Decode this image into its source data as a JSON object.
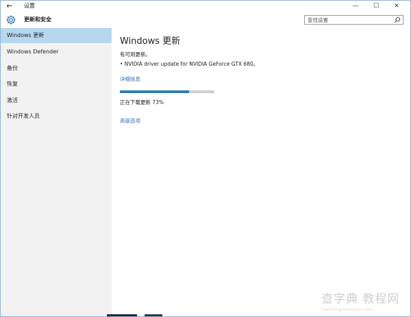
{
  "window": {
    "back_glyph": "←",
    "title": "设置",
    "controls": {
      "minimize": "—",
      "maximize": "☐",
      "close": "✕"
    }
  },
  "header": {
    "title": "更新和安全",
    "icon": "gear-icon"
  },
  "search": {
    "placeholder": "查找设置",
    "icon": "search-icon"
  },
  "sidebar": {
    "items": [
      {
        "label": "Windows 更新",
        "active": true
      },
      {
        "label": "Windows Defender",
        "active": false
      },
      {
        "label": "备份",
        "active": false
      },
      {
        "label": "恢复",
        "active": false
      },
      {
        "label": "激活",
        "active": false
      },
      {
        "label": "针对开发人员",
        "active": false
      }
    ]
  },
  "main": {
    "title": "Windows 更新",
    "available_text": "有可用更新。",
    "update_item": "• NVIDIA driver update for NVIDIA GeForce GTX 680。",
    "details_link": "详细信息",
    "progress_percent": 73,
    "status_text": "正在下载更新 73%",
    "advanced_link": "高级选项"
  },
  "watermark": {
    "text": "查字典 教程网",
    "url": "jiaocheng.chazidian.com"
  },
  "colors": {
    "accent": "#2f7fb4",
    "link": "#2a6eb3",
    "sidebar_bg": "#f2f2f2",
    "sidebar_active": "#b6d7ee"
  }
}
